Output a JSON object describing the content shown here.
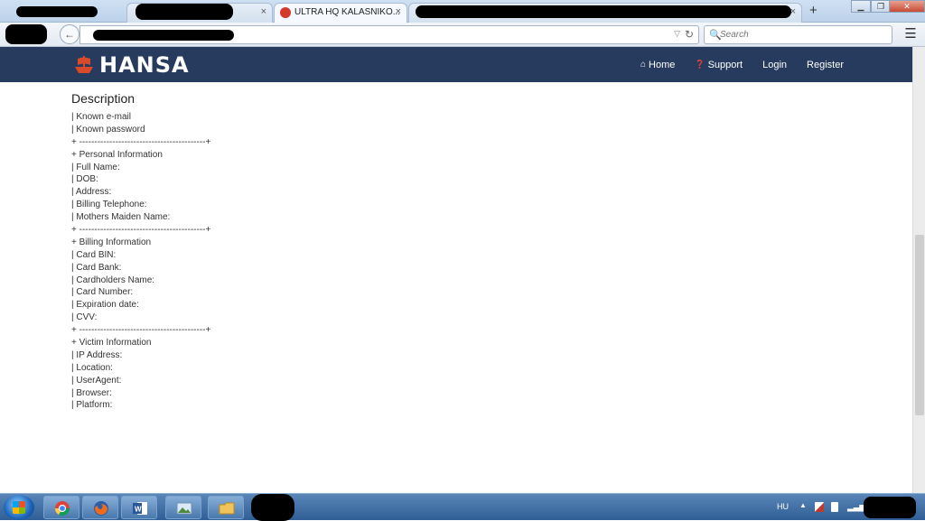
{
  "browser": {
    "tabs": [
      {
        "label": "",
        "redacted": true
      },
      {
        "label": "",
        "redacted": true
      },
      {
        "label": "ULTRA HQ KALASNIKO...",
        "active": true
      },
      {
        "label": "",
        "redacted": true
      }
    ],
    "tab_close_glyph": "×",
    "new_tab_glyph": "+",
    "window_controls": {
      "minimize": "▁",
      "restore": "❐",
      "close": "✕"
    },
    "search": {
      "placeholder": "Search",
      "icon": "magnifier-icon"
    },
    "menu_glyph": "☰",
    "back_glyph": "←",
    "reload_glyph": "↻",
    "dropdown_glyph": "▽"
  },
  "site": {
    "brand": "HANSA",
    "brand_color": "#d94a2b",
    "header_bg": "#263b5e",
    "nav": [
      {
        "label": "Home",
        "icon": "home-icon",
        "glyph": "⌂"
      },
      {
        "label": "Support",
        "icon": "question-circle-icon",
        "glyph": "❓"
      },
      {
        "label": "Login"
      },
      {
        "label": "Register"
      }
    ]
  },
  "main": {
    "title": "Description",
    "lines": [
      "| Known e-mail",
      "| Known password",
      "+ ------------------------------------------+",
      "+ Personal Information",
      "| Full Name:",
      "| DOB:",
      "| Address:",
      "| Billing Telephone:",
      "| Mothers Maiden Name:",
      "+ ------------------------------------------+",
      "+ Billing Information",
      "| Card BIN:",
      "| Card Bank:",
      "| Cardholders Name:",
      "| Card Number:",
      "| Expiration date:",
      "| CVV:",
      "+ ------------------------------------------+",
      "+ Victim Information",
      "| IP Address:",
      "| Location:",
      "| UserAgent:",
      "| Browser:",
      "| Platform:"
    ]
  },
  "taskbar": {
    "apps": [
      "chrome-icon",
      "firefox-icon",
      "word-icon",
      "photo-viewer-icon",
      "file-explorer-icon"
    ],
    "language": "HU",
    "tray_up": "▲",
    "signal": "▂▃▅▇"
  }
}
